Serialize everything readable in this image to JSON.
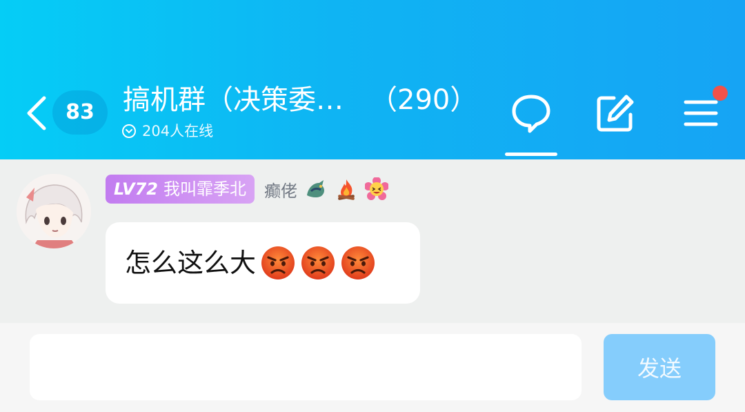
{
  "header": {
    "unread_count": "83",
    "title": "搞机群（决策委…",
    "member_count": "（290）",
    "online_text": "204人在线",
    "back_icon": "chevron-left-icon",
    "online_icon": "chevron-down-circle-icon",
    "chat_icon": "chat-bubble-icon",
    "edit_icon": "edit-icon",
    "menu_icon": "menu-icon",
    "accent": "#0fb4f3",
    "notification_dot_color": "#f2524a"
  },
  "message": {
    "sender": {
      "level": "LV72",
      "nickname": "我叫霏季北",
      "title_tag": "癫佬",
      "badge_color": "#c27cf0",
      "tag_icons": [
        "dragon-icon",
        "campfire-icon",
        "smiley-flower-icon"
      ]
    },
    "text": "怎么这么大",
    "emojis": [
      "angry-face-icon",
      "angry-face-icon",
      "angry-face-icon"
    ]
  },
  "composer": {
    "input_value": "",
    "placeholder": "",
    "send_label": "发送",
    "send_color": "#85cdfc"
  }
}
